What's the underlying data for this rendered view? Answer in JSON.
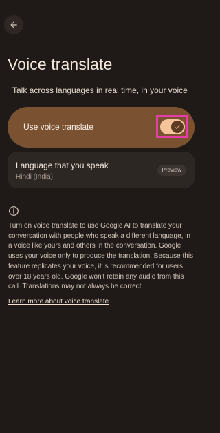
{
  "header": {
    "back_icon": "arrow-left-icon"
  },
  "page": {
    "title": "Voice translate",
    "subtitle": "Talk across languages in real time, in your voice"
  },
  "toggle": {
    "label": "Use voice translate",
    "enabled": true,
    "icon": "check-icon"
  },
  "language": {
    "title": "Language that you speak",
    "value": "Hindi (India)",
    "badge": "Preview"
  },
  "info": {
    "icon": "info-icon",
    "text": "Turn on voice translate to use Google AI to translate your conversation with people who speak a different language, in a voice like yours and others in the conversation. Google uses your voice only to produce the translation. Because this feature replicates your voice, it is recommended for users over 18 years old. Google won't retain any audio from this call. Translations may not always be correct.",
    "link_text": "Learn more about voice translate"
  },
  "colors": {
    "background": "#1f1a17",
    "toggle_card": "#7a5131",
    "switch_track": "#f6c49b",
    "highlight": "#e43fa9"
  }
}
